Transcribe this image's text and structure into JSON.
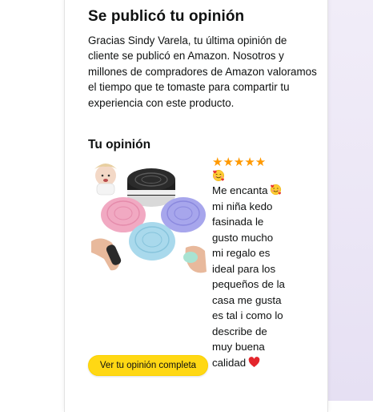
{
  "header": {
    "title": "Se publicó tu opinión",
    "message": "Gracias Sindy Varela, tu última opinión de cliente se publicó en Amazon. Nosotros y millones de compradores de Amazon valoramos el tiempo que te tomaste para compartir tu experiencia con este producto."
  },
  "review": {
    "section_title": "Tu opinión",
    "rating": 5,
    "stars": "★★★★★",
    "star_color": "#ff9900",
    "lines": [
      "Me encanta",
      "mi niña kedo",
      "fasinada le",
      "gusto mucho",
      "mi regalo es",
      "ideal para los",
      "pequeños de la",
      "casa me gusta",
      "es tal i como lo",
      "describe de",
      "muy buena",
      "calidad"
    ],
    "emoji_icons": [
      "smiling-face-with-hearts-icon",
      "red-heart-icon"
    ],
    "product_image": "squishy-sandwich-cookie-toys-image"
  },
  "cta": {
    "label": "Ver tu opinión completa",
    "color": "#ffd814"
  }
}
